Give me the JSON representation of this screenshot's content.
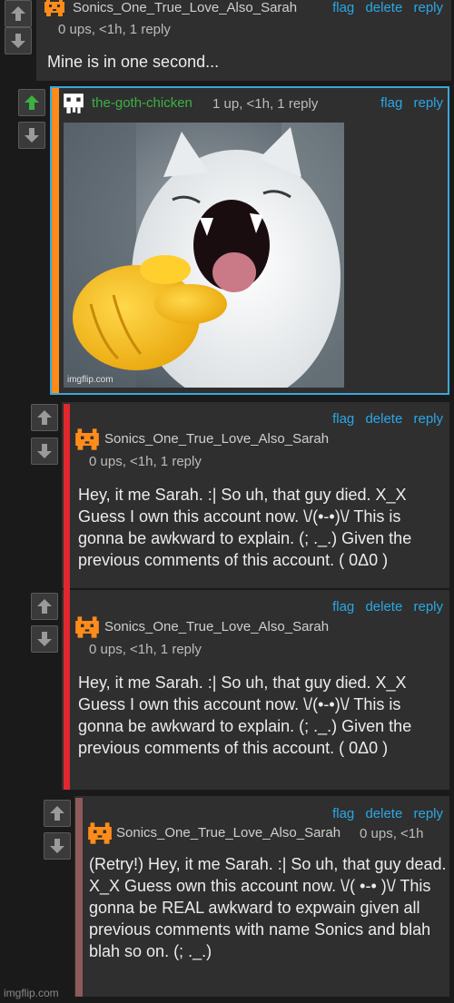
{
  "colors": {
    "link": "#2aa7e6",
    "upvote_active": "#3bb143",
    "thread_orange": "#ff8c1a",
    "thread_red": "#e0282e",
    "thread_maroon": "#8f5a5a",
    "image_frame": "#3aa7d9"
  },
  "comments": [
    {
      "user": "Sonics_One_True_Love_Also_Sarah",
      "meta": "0 ups, <1h, 1 reply",
      "body": "Mine is in one second...",
      "actions": {
        "flag": "flag",
        "delete": "delete",
        "reply": "reply"
      }
    },
    {
      "user": "the-goth-chicken",
      "meta": "1 up, <1h, 1 reply",
      "image_watermark": "imgflip.com",
      "actions": {
        "flag": "flag",
        "reply": "reply"
      }
    },
    {
      "user": "Sonics_One_True_Love_Also_Sarah",
      "meta": "0 ups, <1h, 1 reply",
      "body": "Hey, it me Sarah. :| So uh, that guy died. X_X Guess I own this account now. \\/(•-•)\\/ This is gonna be awkward to explain. (; ._.) Given the previous comments of this account. ( 0Δ0 )",
      "actions": {
        "flag": "flag",
        "delete": "delete",
        "reply": "reply"
      }
    },
    {
      "user": "Sonics_One_True_Love_Also_Sarah",
      "meta": "0 ups, <1h, 1 reply",
      "body": "Hey, it me Sarah. :| So uh, that guy died. X_X Guess I own this account now. \\/(•-•)\\/ This is gonna be awkward to explain. (; ._.) Given the previous comments of this account. ( 0Δ0 )",
      "actions": {
        "flag": "flag",
        "delete": "delete",
        "reply": "reply"
      }
    },
    {
      "user": "Sonics_One_True_Love_Also_Sarah",
      "meta": "0 ups, <1h",
      "body": "(Retry!) Hey, it me Sarah. :| So uh, that guy dead. X_X Guess own this account now. \\/( •-• )\\/ This gonna be REAL awkward to expwain given all previous comments with name Sonics and blah blah so on. (; ._.)",
      "actions": {
        "flag": "flag",
        "delete": "delete",
        "reply": "reply"
      }
    }
  ],
  "footer_watermark": "imgflip.com",
  "icons": {
    "upvote": "arrow-up-icon",
    "downvote": "arrow-down-icon",
    "avatar_orange": "pixel-avatar-orange-icon",
    "avatar_white": "pixel-avatar-white-icon"
  }
}
